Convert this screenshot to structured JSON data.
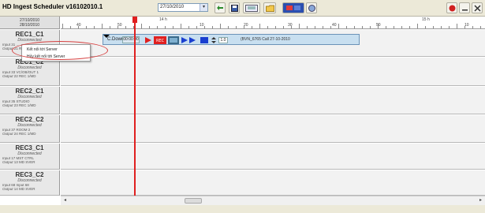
{
  "window": {
    "title": "HD Ingest Scheduler v16102010.1",
    "date_select": "27/10/2010"
  },
  "toolbar": {
    "icons": [
      "refresh-icon",
      "save-icon",
      "monitor-icon",
      "folder-icon",
      "channel-view-icon",
      "globe-icon",
      "record-icon",
      "minimize-icon",
      "close-icon"
    ]
  },
  "left_header": {
    "date_from": "27/10/2010",
    "date_to": "28/10/2010"
  },
  "ruler": {
    "labels": [
      "40",
      "50",
      "14 h",
      "10",
      "20",
      "30",
      "40",
      "50",
      "15 h",
      "10"
    ]
  },
  "channels": [
    {
      "name": "REC1_C1",
      "status": "Disconnected",
      "input_label": "Input",
      "input": "31 ...",
      "output_label": "Output",
      "output": "21 RE..."
    },
    {
      "name": "REC1_C2",
      "status": "Disconnected",
      "input_label": "Input",
      "input": "33 VC/OB/OUT 1",
      "output_label": "Output",
      "output": "22 REC 1/MD"
    },
    {
      "name": "REC2_C1",
      "status": "Disconnected",
      "input_label": "Input",
      "input": "35 STUDIO",
      "output_label": "Output",
      "output": "23 REC 1/MD"
    },
    {
      "name": "REC2_C2",
      "status": "Disconnected",
      "input_label": "Input",
      "input": "37 ROOM 2",
      "output_label": "Output",
      "output": "24 REC 1/MD"
    },
    {
      "name": "REC3_C1",
      "status": "Disconnected",
      "input_label": "Input",
      "input": "17 MST CTRL",
      "output_label": "Output",
      "output": "13 MD SVER"
    },
    {
      "name": "REC3_C2",
      "status": "Disconnected",
      "input_label": "Input",
      "input": "68 Input 68",
      "output_label": "Output",
      "output": "14 MD SVER"
    }
  ],
  "clip": {
    "channel": "C.Down",
    "duration": "00:00:00",
    "count": "1.0",
    "name": "(BVN_6765 Call 27-10-2010"
  },
  "context_menu": {
    "items": [
      "Kết nối tới Server",
      "Hủy kết nối tới Server"
    ]
  },
  "colors": {
    "playhead": "#e02020",
    "clip_bg": "#c8dff0",
    "titlebar": "#ece9d8"
  }
}
